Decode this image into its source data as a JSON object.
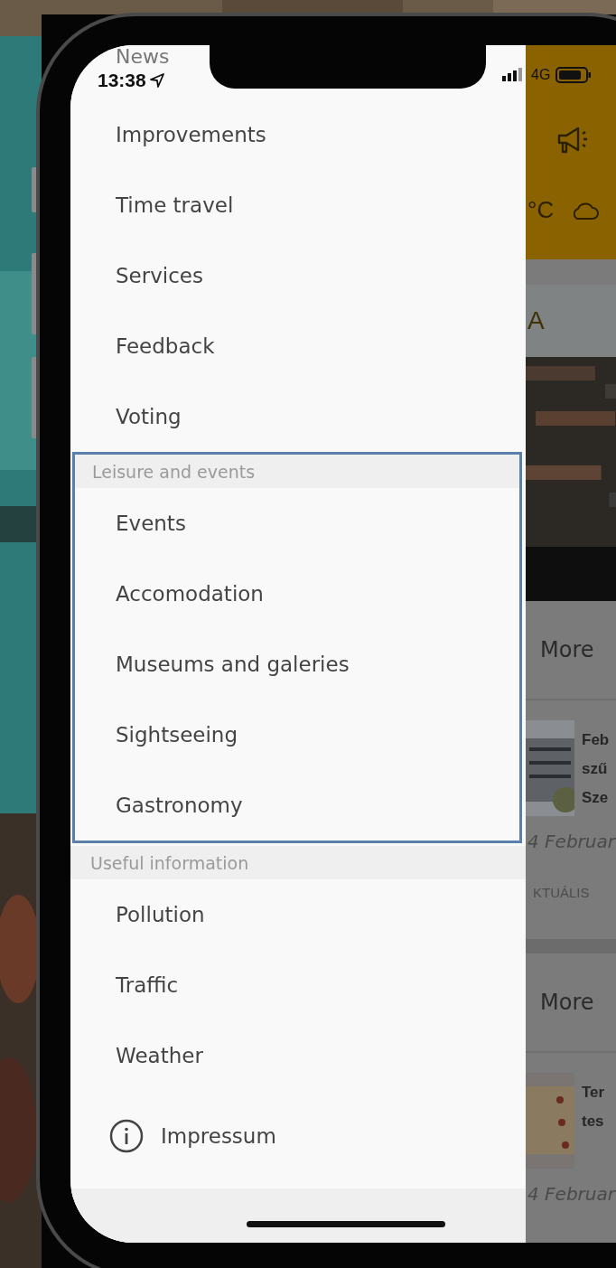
{
  "status_bar": {
    "time": "13:38",
    "network": "4G"
  },
  "drawer": {
    "sections": [
      {
        "items": [
          {
            "label": "News",
            "kind": "plain"
          },
          {
            "label": "Improvements",
            "kind": "plain"
          },
          {
            "label": "Time travel",
            "kind": "plain"
          },
          {
            "label": "Services",
            "kind": "plain"
          },
          {
            "label": "Feedback",
            "kind": "plain"
          },
          {
            "label": "Voting",
            "kind": "plain"
          }
        ],
        "highlighted": false
      },
      {
        "title": "Leisure and events",
        "highlighted": true,
        "items": [
          {
            "label": "Events",
            "kind": "plain"
          },
          {
            "label": "Accomodation",
            "kind": "plain"
          },
          {
            "label": "Museums and galeries",
            "kind": "plain"
          },
          {
            "label": "Sightseeing",
            "kind": "plain"
          },
          {
            "label": "Gastronomy",
            "kind": "plain"
          }
        ]
      },
      {
        "title": "Useful information",
        "highlighted": false,
        "items": [
          {
            "label": "Pollution",
            "kind": "plain"
          },
          {
            "label": "Traffic",
            "kind": "plain"
          },
          {
            "label": "Weather",
            "kind": "plain"
          },
          {
            "label": "Impressum",
            "kind": "info"
          }
        ]
      }
    ]
  },
  "background_screen": {
    "header": {
      "temperature_unit": "°C"
    },
    "card": {
      "title": "A"
    },
    "blocks": [
      {
        "more": "More",
        "article": {
          "title_lines": [
            "Feb",
            "szű",
            "Sze"
          ],
          "date": "4 Februar",
          "category": "KTUÁLIS"
        }
      },
      {
        "more": "More",
        "article": {
          "title_lines": [
            "Ter",
            "tes"
          ],
          "date": "4 Februar"
        }
      }
    ]
  }
}
